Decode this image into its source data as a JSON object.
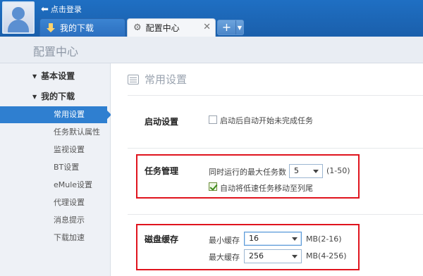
{
  "topbar": {
    "login_label": "点击登录",
    "tabs": [
      {
        "label": "我的下载"
      },
      {
        "label": "配置中心",
        "close": "✕"
      }
    ],
    "new_tab": "+",
    "new_tab_menu": "▼"
  },
  "header": {
    "title": "配置中心"
  },
  "sidebar": {
    "groups": [
      {
        "label": "基本设置"
      },
      {
        "label": "我的下载"
      }
    ],
    "items": [
      {
        "label": "常用设置"
      },
      {
        "label": "任务默认属性"
      },
      {
        "label": "监视设置"
      },
      {
        "label": "BT设置"
      },
      {
        "label": "eMule设置"
      },
      {
        "label": "代理设置"
      },
      {
        "label": "消息提示"
      },
      {
        "label": "下载加速"
      }
    ]
  },
  "main": {
    "section_title": "常用设置",
    "startup": {
      "label": "启动设置",
      "checkbox_label": "启动后自动开始未完成任务",
      "checked": false
    },
    "task": {
      "label": "任务管理",
      "max_tasks_label": "同时运行的最大任务数",
      "max_tasks_value": "5",
      "max_tasks_range": "(1-50)",
      "move_slow_label": "自动将低速任务移动至列尾",
      "move_slow_checked": true
    },
    "cache": {
      "label": "磁盘缓存",
      "min_label": "最小缓存",
      "min_value": "16",
      "min_unit": "MB(2-16)",
      "max_label": "最大缓存",
      "max_value": "256",
      "max_unit": "MB(4-256)"
    }
  },
  "colors": {
    "topbar": "#1f6fc3",
    "accent": "#2f7fd0",
    "highlight_box": "#e0141e"
  }
}
